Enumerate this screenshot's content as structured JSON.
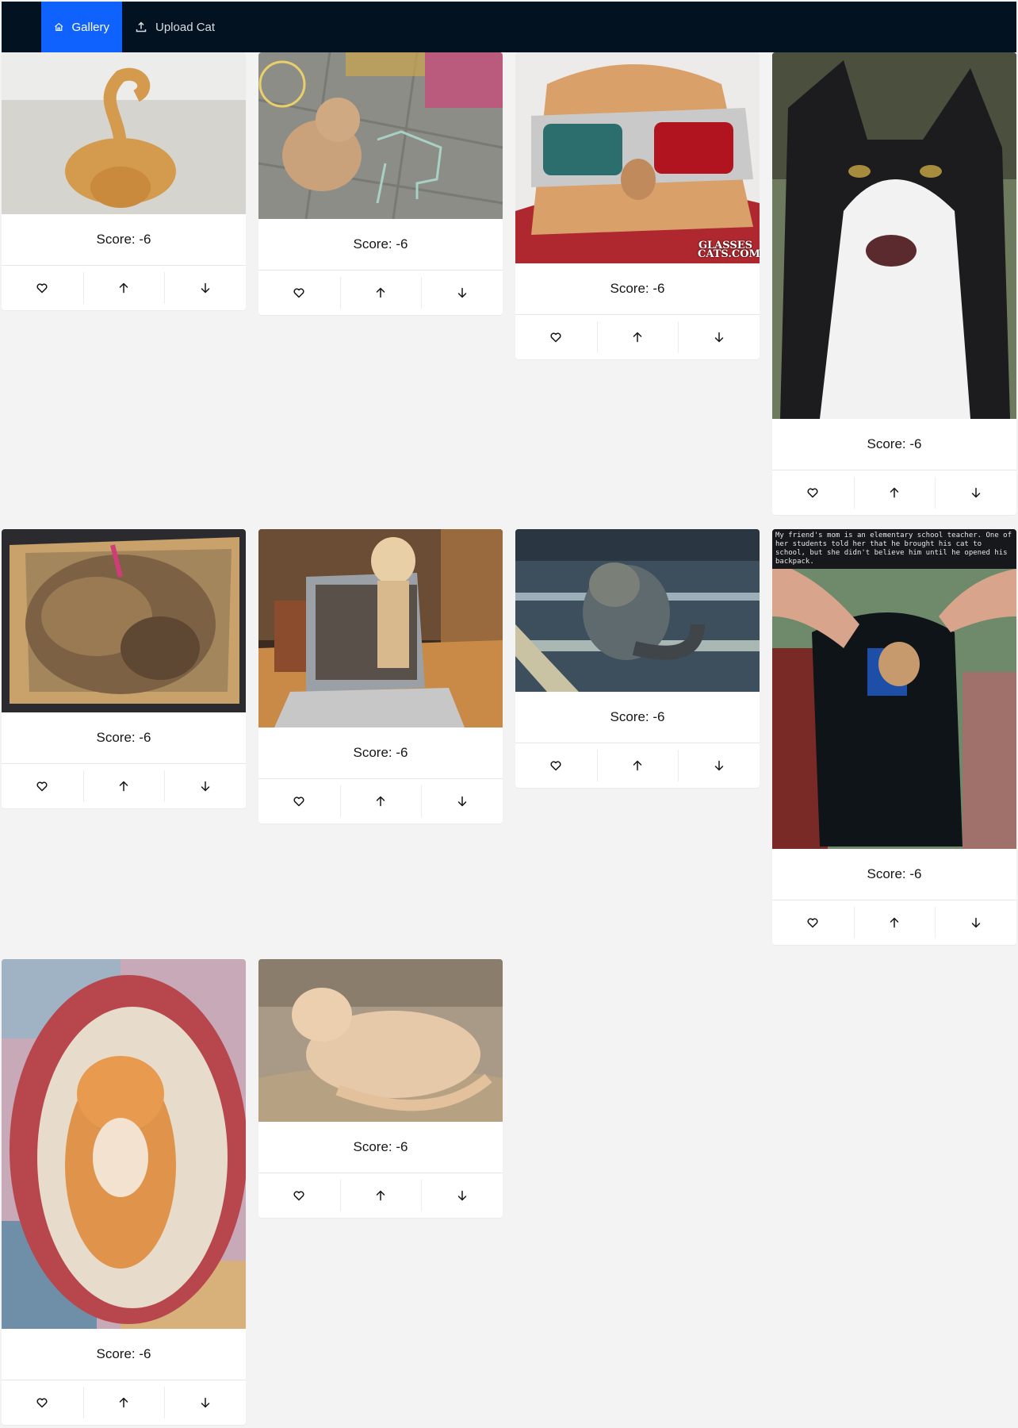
{
  "nav": {
    "gallery_label": "Gallery",
    "upload_label": "Upload Cat"
  },
  "actions": {
    "favorite_icon": "heart-icon",
    "upvote_icon": "arrow-up-icon",
    "downvote_icon": "arrow-down-icon"
  },
  "cards": [
    {
      "score_text": "Score: -6",
      "photo": "orange cat lying flat on floor"
    },
    {
      "score_text": "Score: -6",
      "photo": "cat sitting on pavement with chalk drawings"
    },
    {
      "score_text": "Score: -6",
      "photo": "orange cat wearing 3D glasses",
      "watermark": "GLASSES CATS.COM"
    },
    {
      "score_text": "Score: -6",
      "photo": "black and white cat hissing"
    },
    {
      "score_text": "Score: -6",
      "photo": "tortoiseshell cat curled in cardboard box"
    },
    {
      "score_text": "Score: -6",
      "photo": "cat behind laptop screen"
    },
    {
      "score_text": "Score: -6",
      "photo": "long-haired cat on wooden beam"
    },
    {
      "score_text": "Score: -6",
      "photo": "cat inside a backpack",
      "caption": "My friend's mom is an elementary school teacher. One of her students told her that he brought his cat to school, but she didn't believe him until he opened his backpack."
    },
    {
      "score_text": "Score: -6",
      "photo": "orange kitten on its back in a basket"
    },
    {
      "score_text": "Score: -6",
      "photo": "cream cat lying on a rug"
    }
  ]
}
